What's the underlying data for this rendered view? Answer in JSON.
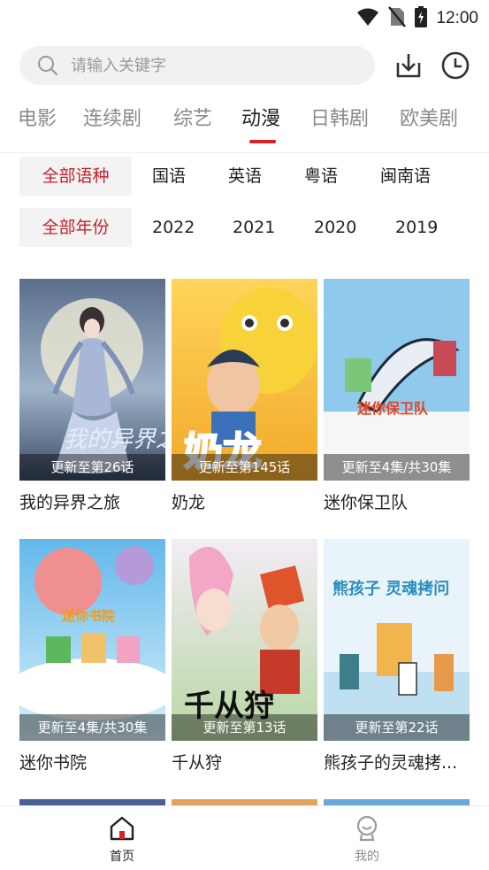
{
  "status_bar": {
    "time": "12:00"
  },
  "search": {
    "placeholder": "请输入关键字"
  },
  "tabs": [
    {
      "label": "电影",
      "active": false
    },
    {
      "label": "连续剧",
      "active": false
    },
    {
      "label": "综艺",
      "active": false
    },
    {
      "label": "动漫",
      "active": true
    },
    {
      "label": "日韩剧",
      "active": false
    },
    {
      "label": "欧美剧",
      "active": false
    }
  ],
  "filters": {
    "language": [
      "全部语种",
      "国语",
      "英语",
      "粤语",
      "闽南语"
    ],
    "year": [
      "全部年份",
      "2022",
      "2021",
      "2020",
      "2019"
    ]
  },
  "items": [
    {
      "title": "我的异界之旅",
      "caption": "更新至第26话",
      "poster_text": "我的异界之旅"
    },
    {
      "title": "奶龙",
      "caption": "更新至第145话",
      "poster_text": "奶龙"
    },
    {
      "title": "迷你保卫队",
      "caption": "更新至4集/共30集",
      "poster_text": "迷你保卫队"
    },
    {
      "title": "迷你书院",
      "caption": "更新至4集/共30集",
      "poster_text": "迷你书院"
    },
    {
      "title": "千从狩",
      "caption": "更新至第13话",
      "poster_text": "千从狩"
    },
    {
      "title": "熊孩子的灵魂拷...",
      "caption": "更新至第22话",
      "poster_text": "熊孩子 灵魂拷问"
    }
  ],
  "bottom_nav": [
    {
      "label": "首页",
      "active": true
    },
    {
      "label": "我的",
      "active": false
    }
  ],
  "colors": {
    "accent": "#d6202a",
    "active_filter_text": "#c4222b",
    "inactive_tab": "#8a8a8a"
  }
}
